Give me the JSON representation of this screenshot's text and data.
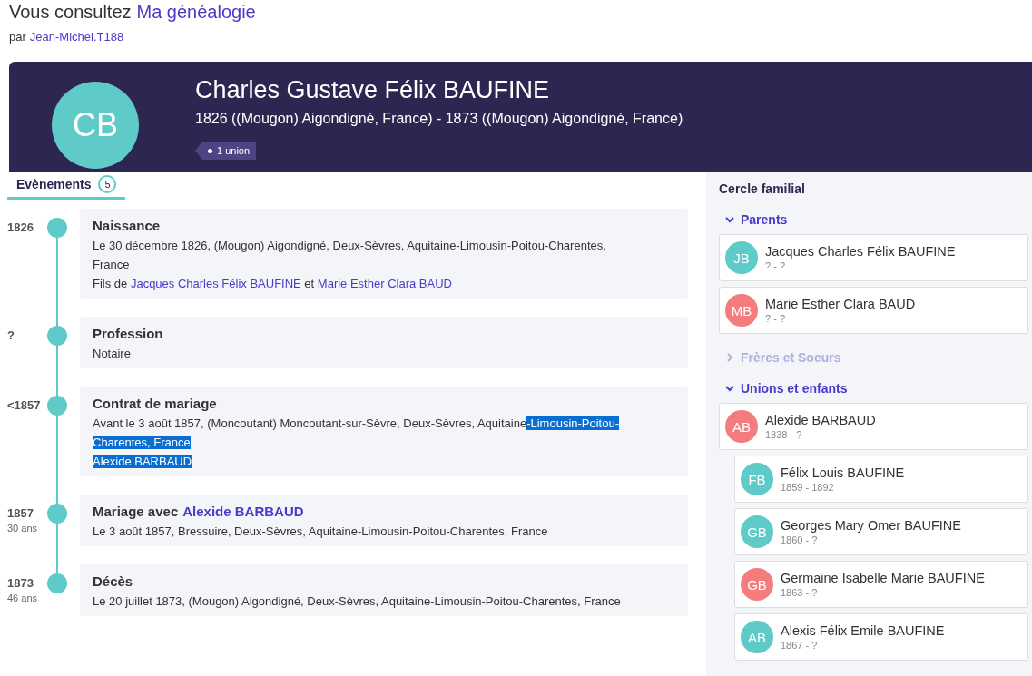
{
  "header": {
    "prefix": "Vous consultez",
    "tree_link": "Ma généalogie",
    "by_prefix": "par",
    "author_link": "Jean-Michel.T188"
  },
  "person": {
    "initials": "CB",
    "color": "#5ecbc8",
    "name": "Charles Gustave Félix BAUFINE",
    "dates": "1826 ((Mougon) Aigondigné, France) - 1873 ((Mougon) Aigondigné, France)",
    "union_badge": "1 union"
  },
  "tabs": [
    {
      "label": "Evènements",
      "count": "5",
      "selected": true
    }
  ],
  "events": [
    {
      "year": "1826",
      "title": "Naissance",
      "paragraphs": [
        [
          {
            "kind": "plain",
            "text": "Le 30 décembre 1826, (Mougon) Aigondigné, Deux-Sèvres, Aquitaine-Limousin-Poitou-Charentes, France"
          }
        ],
        [
          {
            "kind": "plain",
            "text": "Fils de "
          },
          {
            "kind": "link",
            "text": "Jacques Charles Félix BAUFINE"
          },
          {
            "kind": "plain",
            "text": " et "
          },
          {
            "kind": "link",
            "text": "Marie Esther Clara BAUD"
          }
        ]
      ]
    },
    {
      "year": "?",
      "title": "Profession",
      "paragraphs": [
        [
          {
            "kind": "plain",
            "text": "Notaire"
          }
        ]
      ]
    },
    {
      "year": "<1857",
      "title": "Contrat de mariage",
      "paragraphs": [
        [
          {
            "kind": "plain",
            "text": "Avant le 3 août 1857, (Moncoutant) Moncoutant-sur-Sèvre, Deux-Sèvres, Aquitaine"
          },
          {
            "kind": "selected",
            "text": "-Limousin-Poitou-Charentes, France"
          }
        ],
        [
          {
            "kind": "selected",
            "text": "Alexide BARBAUD"
          }
        ]
      ]
    },
    {
      "year": "1857",
      "age": "30 ans",
      "title": "Mariage avec",
      "title_link": "Alexide BARBAUD",
      "paragraphs": [
        [
          {
            "kind": "plain",
            "text": "Le 3 août 1857, Bressuire, Deux-Sèvres, Aquitaine-Limousin-Poitou-Charentes, France"
          }
        ]
      ]
    },
    {
      "year": "1873",
      "age": "46 ans",
      "title": "Décès",
      "paragraphs": [
        [
          {
            "kind": "plain",
            "text": "Le 20 juillet 1873, (Mougon) Aigondigné, Deux-Sèvres, Aquitaine-Limousin-Poitou-Charentes, France"
          }
        ]
      ]
    }
  ],
  "family": {
    "title": "Cercle familial",
    "sections": [
      {
        "label": "Parents",
        "expanded": true,
        "disabled": false,
        "people": [
          {
            "initials": "JB",
            "color": "#5ecbc8",
            "name": "Jacques Charles Félix BAUFINE",
            "dates": "? - ?"
          },
          {
            "initials": "MB",
            "color": "#f47c7c",
            "name": "Marie Esther Clara BAUD",
            "dates": "? - ?"
          }
        ]
      },
      {
        "label": "Frères et Soeurs",
        "expanded": false,
        "disabled": true
      },
      {
        "label": "Unions et enfants",
        "expanded": true,
        "disabled": false,
        "people": [
          {
            "initials": "AB",
            "color": "#f47c7c",
            "name": "Alexide BARBAUD",
            "dates": "1838 - ?",
            "children": [
              {
                "initials": "FB",
                "color": "#5ecbc8",
                "name": "Félix Louis BAUFINE",
                "dates": "1859 - 1892"
              },
              {
                "initials": "GB",
                "color": "#5ecbc8",
                "name": "Georges Mary Omer BAUFINE",
                "dates": "1860 - ?"
              },
              {
                "initials": "GB",
                "color": "#f47c7c",
                "name": "Germaine Isabelle Marie BAUFINE",
                "dates": "1863 - ?"
              },
              {
                "initials": "AB",
                "color": "#5ecbc8",
                "name": "Alexis Félix Emile BAUFINE",
                "dates": "1867 - ?"
              }
            ]
          }
        ]
      }
    ]
  }
}
